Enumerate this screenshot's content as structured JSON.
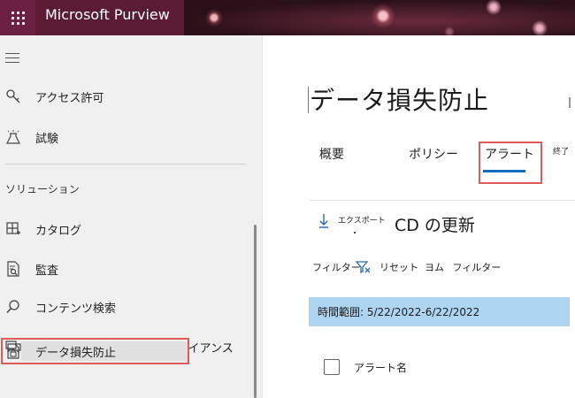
{
  "header": {
    "app_title": "Microsoft Purview",
    "waffle_icon": "app-launcher-icon",
    "accent": "#5b1b33"
  },
  "sidebar": {
    "items": [
      {
        "label": "アクセス許可",
        "icon": "key-icon"
      },
      {
        "label": "試験",
        "icon": "lab-flask-icon"
      },
      {
        "label": "カタログ",
        "icon": "catalog-grid-icon"
      },
      {
        "label": "監査",
        "icon": "audit-document-icon"
      },
      {
        "label": "コンテンツ検索",
        "icon": "search-icon"
      },
      {
        "label": "コミュニケーション コンプライアンス",
        "icon": "chat-bubbles-icon"
      },
      {
        "label": "データ損失防止",
        "icon": "lock-document-icon"
      }
    ],
    "section_label": "ソリューション"
  },
  "main": {
    "title": "データ損失防止",
    "tabs": [
      {
        "label": "概要"
      },
      {
        "label": "ポリシー"
      },
      {
        "label": "アラート"
      }
    ],
    "tab_overflow_label": "終了",
    "toolbar": {
      "export_label": "エクスポート",
      "refresh_text": "CD の更新"
    },
    "filters": {
      "filter_label": "フィルター",
      "reset_label": "リセット",
      "yomu_label": "ヨム",
      "filter2_label": "フィルター"
    },
    "date_range": "時間範囲: 5/22/2022-6/22/2022",
    "table": {
      "columns": [
        "アラート名"
      ]
    }
  }
}
